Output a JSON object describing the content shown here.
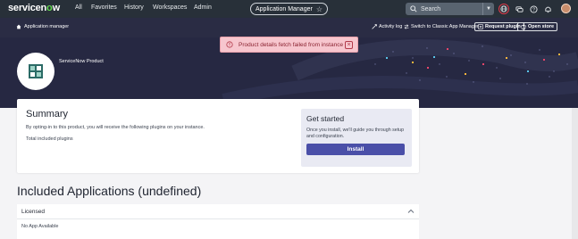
{
  "topnav": {
    "logo_text_a": "servicen",
    "logo_text_o": "o",
    "logo_text_b": "w",
    "items": [
      {
        "label": "All"
      },
      {
        "label": "Favorites"
      },
      {
        "label": "History"
      },
      {
        "label": "Workspaces"
      },
      {
        "label": "Admin"
      }
    ],
    "app_pill": "Application Manager",
    "search_placeholder": "Search"
  },
  "subbar": {
    "breadcrumb": "Application manager",
    "activity_log": "Activity log",
    "switch_classic": "Switch to Classic App Manager",
    "request_plugin": "Request plugin",
    "open_store": "Open store"
  },
  "toast": {
    "message": "Product details fetch failed from instance"
  },
  "hero": {
    "product_name": "ServiceNow Product"
  },
  "summary": {
    "title": "Summary",
    "description": "By opting-in to this product, you will receive the following plugins on your instance.",
    "total_label": "Total included plugins"
  },
  "get_started": {
    "title": "Get started",
    "description": "Once you install, we'll guide you through setup and configuration.",
    "install_label": "Install"
  },
  "included": {
    "title": "Included Applications (undefined)",
    "panel_label": "Licensed",
    "empty_text": "No App Available"
  },
  "colors": {
    "topnav_bg": "#283039",
    "hero_bg": "#262842",
    "accent": "#4a4fa8",
    "toast_bg": "#f7c6ce"
  }
}
